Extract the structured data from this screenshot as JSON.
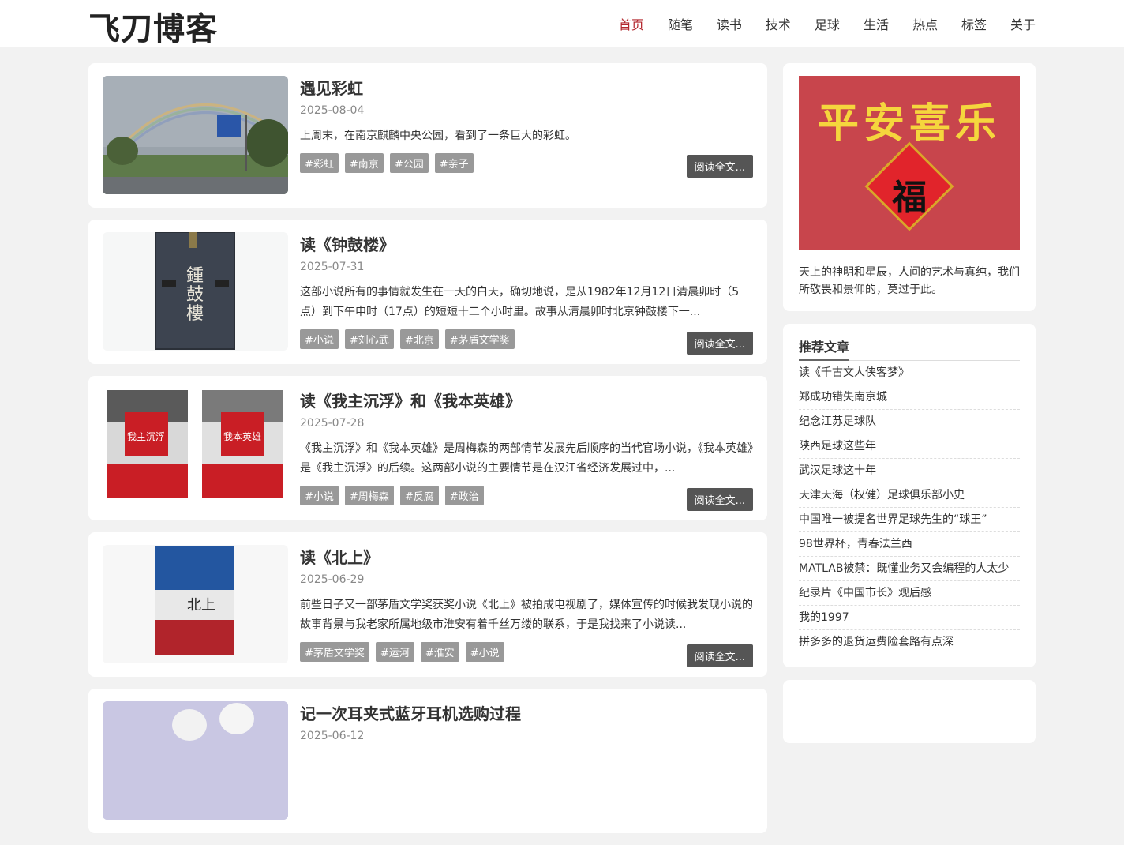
{
  "site": {
    "logo": "飞刀博客"
  },
  "nav": [
    {
      "label": "首页",
      "active": true
    },
    {
      "label": "随笔"
    },
    {
      "label": "读书"
    },
    {
      "label": "技术"
    },
    {
      "label": "足球"
    },
    {
      "label": "生活"
    },
    {
      "label": "热点"
    },
    {
      "label": "标签"
    },
    {
      "label": "关于"
    }
  ],
  "posts": [
    {
      "title": "遇见彩虹",
      "date": "2025-08-04",
      "excerpt": "上周末，在南京麒麟中央公园，看到了一条巨大的彩虹。",
      "tags": [
        "#彩虹",
        "#南京",
        "#公园",
        "#亲子"
      ],
      "read_more": "阅读全文..."
    },
    {
      "title": "读《钟鼓楼》",
      "date": "2025-07-31",
      "excerpt": "这部小说所有的事情就发生在一天的白天，确切地说，是从1982年12月12日清晨卯时（5点）到下午申时（17点）的短短十二个小时里。故事从清晨卯时北京钟鼓楼下一...",
      "tags": [
        "#小说",
        "#刘心武",
        "#北京",
        "#茅盾文学奖"
      ],
      "read_more": "阅读全文..."
    },
    {
      "title": "读《我主沉浮》和《我本英雄》",
      "date": "2025-07-28",
      "excerpt": "《我主沉浮》和《我本英雄》是周梅森的两部情节发展先后顺序的当代官场小说，《我本英雄》是《我主沉浮》的后续。这两部小说的主要情节是在汉江省经济发展过中，...",
      "tags": [
        "#小说",
        "#周梅森",
        "#反腐",
        "#政治"
      ],
      "read_more": "阅读全文..."
    },
    {
      "title": "读《北上》",
      "date": "2025-06-29",
      "excerpt": "前些日子又一部茅盾文学奖获奖小说《北上》被拍成电视剧了，媒体宣传的时候我发现小说的故事背景与我老家所属地级市淮安有着千丝万缕的联系，于是我找来了小说读...",
      "tags": [
        "#茅盾文学奖",
        "#运河",
        "#淮安",
        "#小说"
      ],
      "read_more": "阅读全文..."
    },
    {
      "title": "记一次耳夹式蓝牙耳机选购过程",
      "date": "2025-06-12",
      "excerpt": "",
      "tags": [],
      "read_more": ""
    }
  ],
  "sidebar": {
    "poster_text": "平安喜乐",
    "poster_fu": "福",
    "quote": "天上的神明和星辰，人间的艺术与真纯，我们所敬畏和景仰的，莫过于此。",
    "recommend_title": "推荐文章",
    "recommend": [
      "读《千古文人侠客梦》",
      "郑成功错失南京城",
      "纪念江苏足球队",
      "陕西足球这些年",
      "武汉足球这十年",
      "天津天海（权健）足球俱乐部小史",
      "中国唯一被提名世界足球先生的“球王”",
      "98世界杯，青春法兰西",
      "MATLAB被禁：既懂业务又会编程的人太少",
      "纪录片《中国市长》观后感",
      "我的1997",
      "拼多多的退货运费险套路有点深"
    ]
  }
}
